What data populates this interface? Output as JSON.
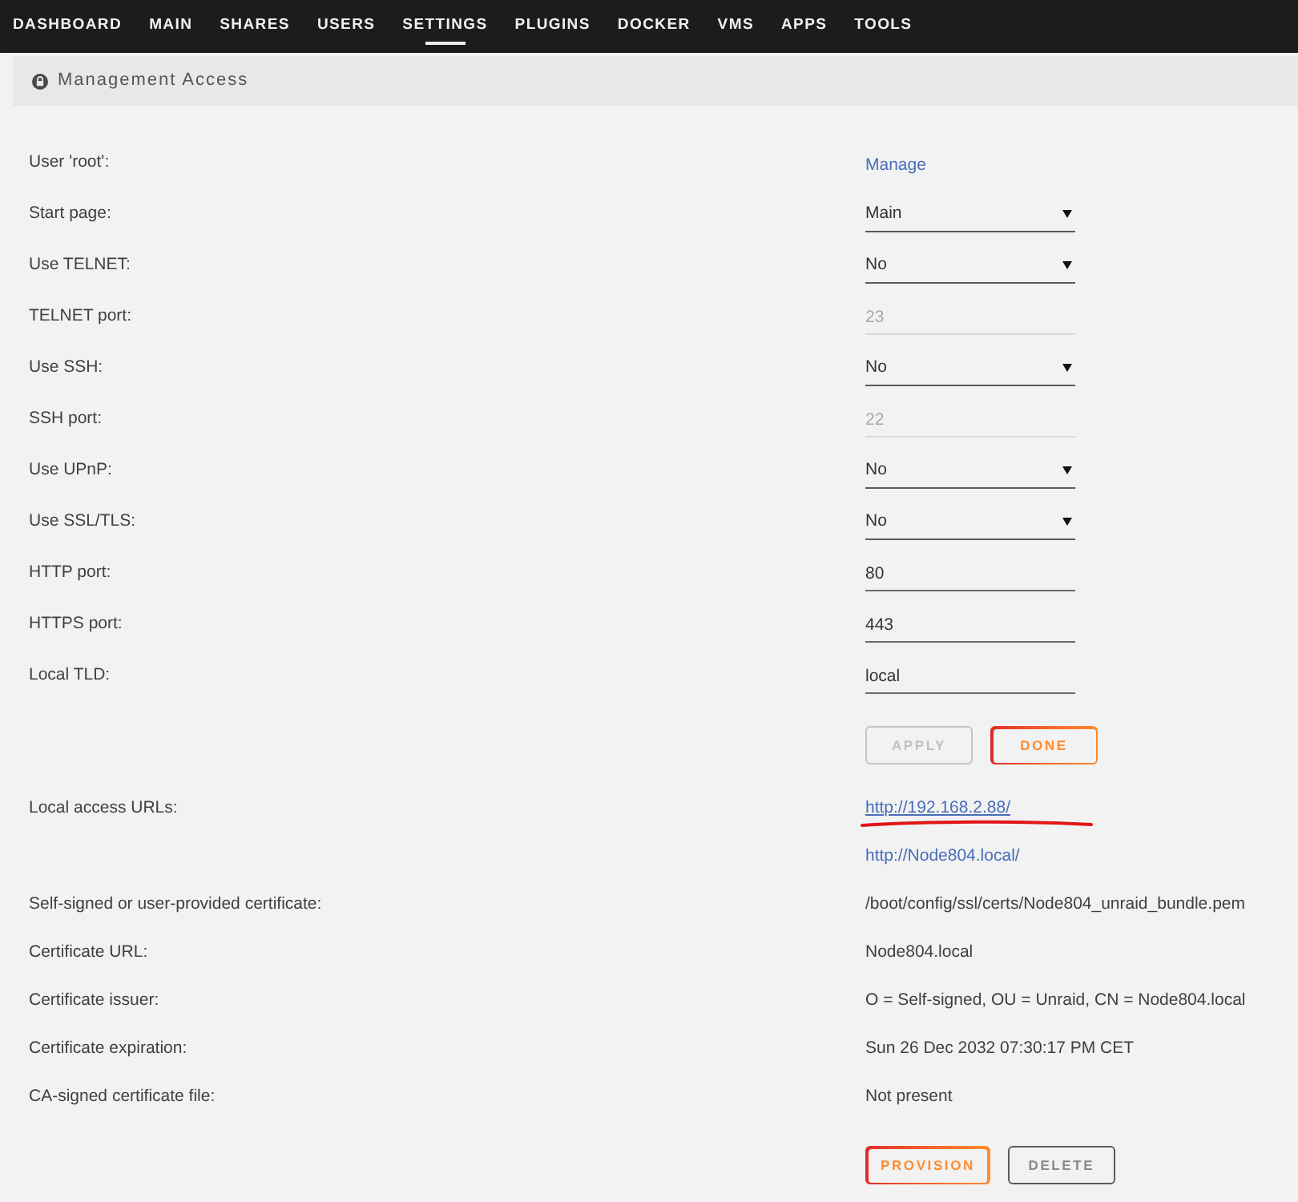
{
  "nav": {
    "items": [
      {
        "label": "DASHBOARD",
        "selected": false
      },
      {
        "label": "MAIN",
        "selected": false
      },
      {
        "label": "SHARES",
        "selected": false
      },
      {
        "label": "USERS",
        "selected": false
      },
      {
        "label": "SETTINGS",
        "selected": true
      },
      {
        "label": "PLUGINS",
        "selected": false
      },
      {
        "label": "DOCKER",
        "selected": false
      },
      {
        "label": "VMS",
        "selected": false
      },
      {
        "label": "APPS",
        "selected": false
      },
      {
        "label": "TOOLS",
        "selected": false
      }
    ]
  },
  "section": {
    "title": "Management Access"
  },
  "settings": [
    {
      "kind": "link",
      "label": "User 'root':",
      "value": "Manage"
    },
    {
      "kind": "select",
      "label": "Start page:",
      "value": "Main"
    },
    {
      "kind": "select",
      "label": "Use TELNET:",
      "value": "No"
    },
    {
      "kind": "input",
      "label": "TELNET port:",
      "value": "23",
      "disabled": true
    },
    {
      "kind": "select",
      "label": "Use SSH:",
      "value": "No"
    },
    {
      "kind": "input",
      "label": "SSH port:",
      "value": "22",
      "disabled": true
    },
    {
      "kind": "select",
      "label": "Use UPnP:",
      "value": "No"
    },
    {
      "kind": "select",
      "label": "Use SSL/TLS:",
      "value": "No"
    },
    {
      "kind": "input",
      "label": "HTTP port:",
      "value": "80",
      "disabled": false
    },
    {
      "kind": "input",
      "label": "HTTPS port:",
      "value": "443",
      "disabled": false
    },
    {
      "kind": "input",
      "label": "Local TLD:",
      "value": "local",
      "disabled": false
    },
    {
      "kind": "buttons",
      "buttons": [
        {
          "label": "APPLY",
          "kind": "plain",
          "disabled": true
        },
        {
          "label": "DONE",
          "kind": "accent",
          "disabled": false
        }
      ]
    },
    {
      "kind": "links",
      "label": "Local access URLs:",
      "links": [
        {
          "text": "http://192.168.2.88/",
          "highlighted": true
        },
        {
          "text": "http://Node804.local/",
          "highlighted": false
        }
      ]
    },
    {
      "kind": "text",
      "label": "Self-signed or user-provided certificate:",
      "value": "/boot/config/ssl/certs/Node804_unraid_bundle.pem"
    },
    {
      "kind": "text",
      "label": "Certificate URL:",
      "value": "Node804.local"
    },
    {
      "kind": "text",
      "label": "Certificate issuer:",
      "value": "O = Self-signed, OU = Unraid, CN = Node804.local"
    },
    {
      "kind": "text",
      "label": "Certificate expiration:",
      "value": "Sun 26 Dec 2032 07:30:17 PM CET"
    },
    {
      "kind": "text",
      "label": "CA-signed certificate file:",
      "value": "Not present"
    },
    {
      "kind": "buttons",
      "buttons": [
        {
          "label": "PROVISION",
          "kind": "accent",
          "disabled": false
        },
        {
          "label": "DELETE",
          "kind": "plain",
          "disabled": false
        }
      ]
    }
  ]
}
